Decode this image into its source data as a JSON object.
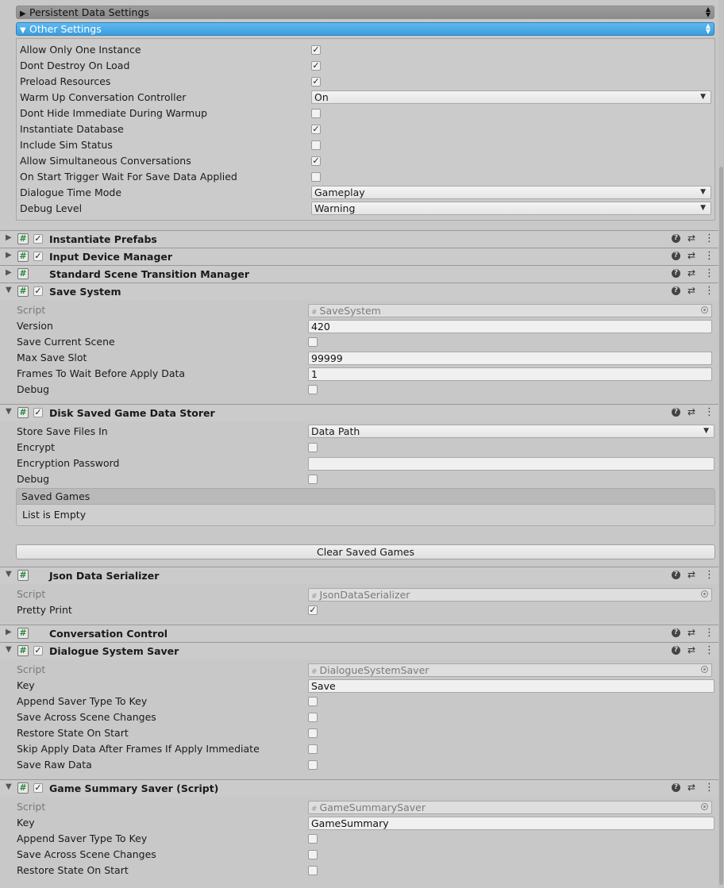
{
  "foldouts": {
    "persistent": {
      "label": "Persistent Data Settings"
    },
    "other": {
      "label": "Other Settings"
    }
  },
  "other_settings": {
    "allow_only_one_instance": {
      "label": "Allow Only One Instance",
      "checked": true
    },
    "dont_destroy_on_load": {
      "label": "Dont Destroy On Load",
      "checked": true
    },
    "preload_resources": {
      "label": "Preload Resources",
      "checked": true
    },
    "warm_up": {
      "label": "Warm Up Conversation Controller",
      "value": "On"
    },
    "dont_hide_immediate": {
      "label": "Dont Hide Immediate During Warmup",
      "checked": false
    },
    "instantiate_database": {
      "label": "Instantiate Database",
      "checked": true
    },
    "include_sim_status": {
      "label": "Include Sim Status",
      "checked": false
    },
    "allow_simultaneous": {
      "label": "Allow Simultaneous Conversations",
      "checked": true
    },
    "on_start_trigger_wait": {
      "label": "On Start Trigger Wait For Save Data Applied",
      "checked": false
    },
    "dialogue_time_mode": {
      "label": "Dialogue Time Mode",
      "value": "Gameplay"
    },
    "debug_level": {
      "label": "Debug Level",
      "value": "Warning"
    }
  },
  "components": {
    "instantiate_prefabs": {
      "title": "Instantiate Prefabs",
      "enabled": true
    },
    "input_device_manager": {
      "title": "Input Device Manager",
      "enabled": true
    },
    "standard_scene_transition": {
      "title": "Standard Scene Transition Manager"
    },
    "save_system": {
      "title": "Save System",
      "enabled": true,
      "script_label": "Script",
      "script_value": "SaveSystem",
      "version_label": "Version",
      "version_value": "420",
      "save_current_scene_label": "Save Current Scene",
      "save_current_scene": false,
      "max_save_slot_label": "Max Save Slot",
      "max_save_slot_value": "99999",
      "frames_to_wait_label": "Frames To Wait Before Apply Data",
      "frames_to_wait_value": "1",
      "debug_label": "Debug",
      "debug": false
    },
    "disk_saved_storer": {
      "title": "Disk Saved Game Data Storer",
      "enabled": true,
      "store_in_label": "Store Save Files In",
      "store_in_value": "Data Path",
      "encrypt_label": "Encrypt",
      "encrypt": false,
      "password_label": "Encryption Password",
      "password_value": "",
      "debug_label": "Debug",
      "debug": false,
      "saved_games_label": "Saved Games",
      "list_empty": "List is Empty",
      "clear_button": "Clear Saved Games"
    },
    "json_serializer": {
      "title": "Json Data Serializer",
      "script_label": "Script",
      "script_value": "JsonDataSerializer",
      "pretty_print_label": "Pretty Print",
      "pretty_print": true
    },
    "conversation_control": {
      "title": "Conversation Control"
    },
    "dialogue_system_saver": {
      "title": "Dialogue System Saver",
      "enabled": true,
      "script_label": "Script",
      "script_value": "DialogueSystemSaver",
      "key_label": "Key",
      "key_value": "Save",
      "append_label": "Append Saver Type To Key",
      "append": false,
      "across_label": "Save Across Scene Changes",
      "across": false,
      "restore_label": "Restore State On Start",
      "restore": false,
      "skip_label": "Skip Apply Data After Frames If Apply Immediate",
      "skip": false,
      "raw_label": "Save Raw Data",
      "raw": false
    },
    "game_summary_saver": {
      "title": "Game Summary Saver (Script)",
      "enabled": true,
      "script_label": "Script",
      "script_value": "GameSummarySaver",
      "key_label": "Key",
      "key_value": "GameSummary",
      "append_label": "Append Saver Type To Key",
      "append": false,
      "across_label": "Save Across Scene Changes",
      "across": false,
      "restore_label": "Restore State On Start",
      "restore": false
    }
  },
  "icons": {
    "fold_open": "▼",
    "fold_closed": "▶",
    "check": "✓",
    "help": "?",
    "preset": "⇄",
    "menu": "⋮",
    "hash": "#",
    "dropdown": "▼"
  }
}
